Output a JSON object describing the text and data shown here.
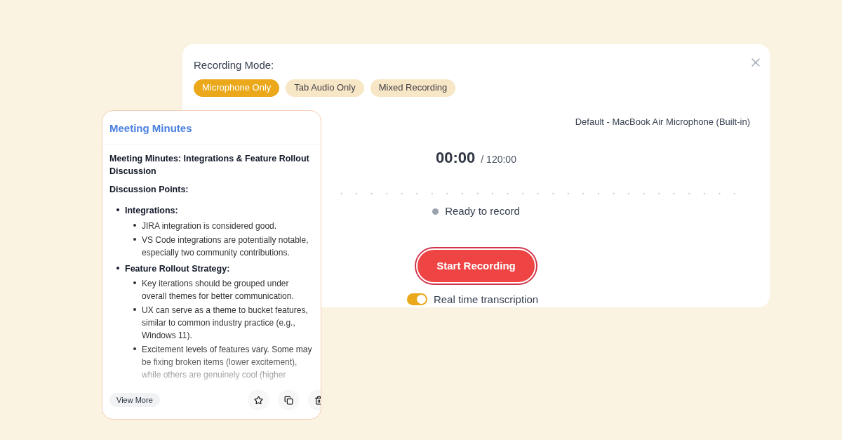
{
  "recorder": {
    "mode_label": "Recording Mode:",
    "modes": [
      {
        "label": "Microphone Only",
        "selected": true
      },
      {
        "label": "Tab Audio Only",
        "selected": false
      },
      {
        "label": "Mixed Recording",
        "selected": false
      }
    ],
    "device": "Default - MacBook Air Microphone (Built-in)",
    "timer": {
      "elapsed": "00:00",
      "limit": "/ 120:00"
    },
    "status": "Ready to record",
    "start_button": "Start Recording",
    "transcription": {
      "label": "Real time transcription",
      "on": true
    }
  },
  "notes_card": {
    "title": "Meeting Minutes",
    "heading": "Meeting Minutes: Integrations & Feature Rollout Discussion",
    "section": "Discussion Points:",
    "points": [
      {
        "text": "Integrations:",
        "children": [
          {
            "text": "JIRA integration is considered good."
          },
          {
            "text": "VS Code integrations are potentially notable, especially two community contributions."
          }
        ]
      },
      {
        "text": "Feature Rollout Strategy:",
        "children": [
          {
            "text": "Key iterations should be grouped under overall themes for better communication."
          },
          {
            "text": "UX can serve as a theme to bucket features, similar to common industry practice (e.g., Windows 11)."
          },
          {
            "text": "Excitement levels of features vary. Some may be fixing broken items (lower excitement), while others are genuinely cool (higher"
          }
        ]
      }
    ],
    "view_more": "View More"
  }
}
